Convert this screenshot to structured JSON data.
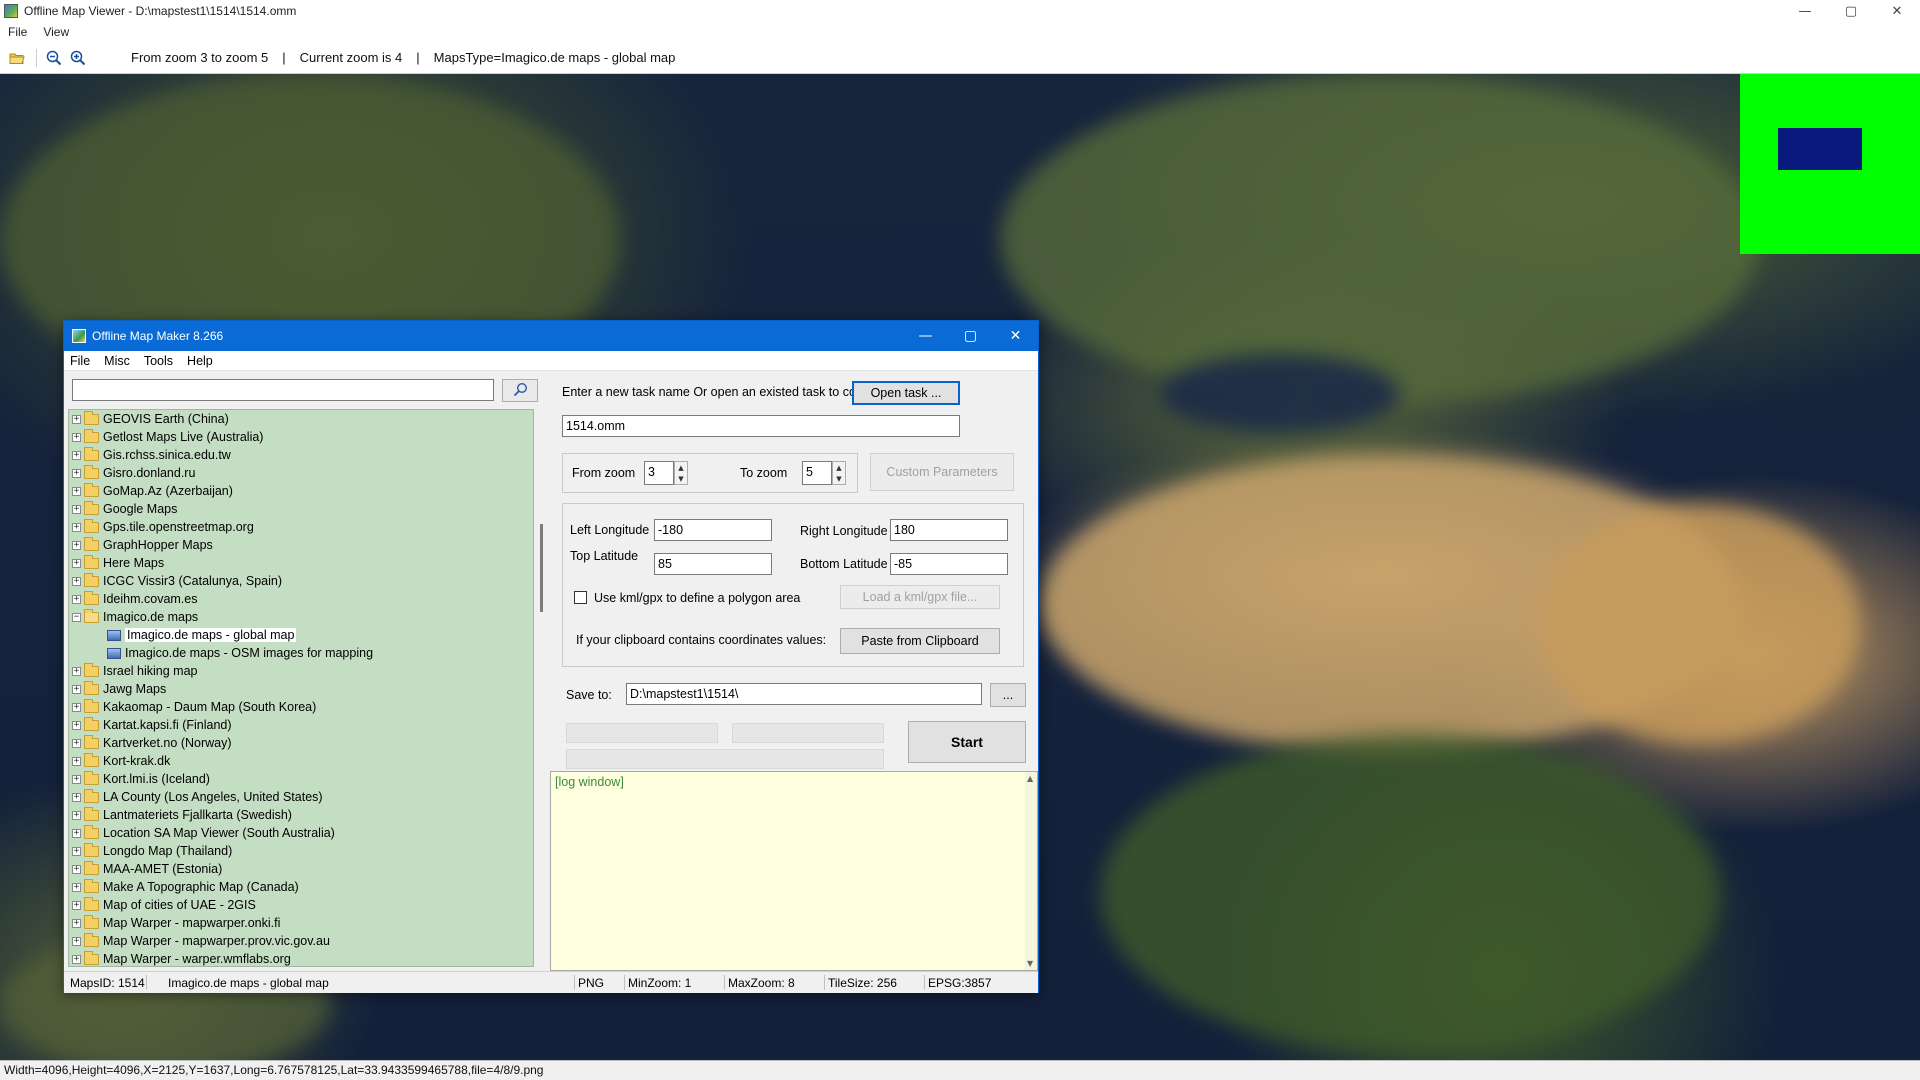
{
  "viewer": {
    "title": "Offline Map Viewer - D:\\mapstest1\\1514\\1514.omm",
    "menu": [
      "File",
      "View"
    ],
    "window_controls": [
      "—",
      "▢",
      "✕"
    ],
    "toolbar": {
      "icons": [
        "open-folder-icon",
        "zoom-out-icon",
        "zoom-in-icon"
      ],
      "zoom_range": "From zoom 3 to zoom 5",
      "current_zoom": "Current zoom is 4",
      "maps_type": "MapsType=Imagico.de maps - global map",
      "separator": "|"
    },
    "status": "Width=4096,Height=4096,X=2125,Y=1637,Long=6.767578125,Lat=33.9433599465788,file=4/8/9.png",
    "overview_colors": {
      "background": "#00ff00",
      "viewport": "#0a1a7c"
    }
  },
  "dialog": {
    "title": "Offline Map Maker 8.266",
    "window_controls": [
      "—",
      "▢",
      "✕"
    ],
    "menu": [
      "File",
      "Misc",
      "Tools",
      "Help"
    ],
    "search": {
      "value": "",
      "icon": "search-icon"
    },
    "tree": [
      {
        "label": "GEOVIS Earth (China)",
        "type": "folder",
        "expander": "+"
      },
      {
        "label": "Getlost Maps Live (Australia)",
        "type": "folder",
        "expander": "+"
      },
      {
        "label": "Gis.rchss.sinica.edu.tw",
        "type": "folder",
        "expander": "+"
      },
      {
        "label": "Gisro.donland.ru",
        "type": "folder",
        "expander": "+"
      },
      {
        "label": "GoMap.Az (Azerbaijan)",
        "type": "folder",
        "expander": "+"
      },
      {
        "label": "Google Maps",
        "type": "folder",
        "expander": "+"
      },
      {
        "label": "Gps.tile.openstreetmap.org",
        "type": "folder",
        "expander": "+"
      },
      {
        "label": "GraphHopper Maps",
        "type": "folder",
        "expander": "+"
      },
      {
        "label": "Here Maps",
        "type": "folder",
        "expander": "+"
      },
      {
        "label": "ICGC Vissir3 (Catalunya, Spain)",
        "type": "folder",
        "expander": "+"
      },
      {
        "label": "Ideihm.covam.es",
        "type": "folder",
        "expander": "+"
      },
      {
        "label": "Imagico.de maps",
        "type": "folder-open",
        "expander": "−"
      },
      {
        "label": "Imagico.de maps - global map",
        "type": "map",
        "selected": true
      },
      {
        "label": "Imagico.de maps - OSM images for mapping",
        "type": "map"
      },
      {
        "label": "Israel hiking map",
        "type": "folder",
        "expander": "+"
      },
      {
        "label": "Jawg Maps",
        "type": "folder",
        "expander": "+"
      },
      {
        "label": "Kakaomap - Daum Map (South Korea)",
        "type": "folder",
        "expander": "+"
      },
      {
        "label": "Kartat.kapsi.fi (Finland)",
        "type": "folder",
        "expander": "+"
      },
      {
        "label": "Kartverket.no (Norway)",
        "type": "folder",
        "expander": "+"
      },
      {
        "label": "Kort-krak.dk",
        "type": "folder",
        "expander": "+"
      },
      {
        "label": "Kort.lmi.is (Iceland)",
        "type": "folder",
        "expander": "+"
      },
      {
        "label": "LA County (Los Angeles, United States)",
        "type": "folder",
        "expander": "+"
      },
      {
        "label": "Lantmateriets Fjallkarta (Swedish)",
        "type": "folder",
        "expander": "+"
      },
      {
        "label": "Location SA Map Viewer (South Australia)",
        "type": "folder",
        "expander": "+"
      },
      {
        "label": "Longdo Map (Thailand)",
        "type": "folder",
        "expander": "+"
      },
      {
        "label": "MAA-AMET (Estonia)",
        "type": "folder",
        "expander": "+"
      },
      {
        "label": "Make A Topographic Map (Canada)",
        "type": "folder",
        "expander": "+"
      },
      {
        "label": "Map of cities of UAE - 2GIS",
        "type": "folder",
        "expander": "+"
      },
      {
        "label": "Map Warper - mapwarper.onki.fi",
        "type": "folder",
        "expander": "+"
      },
      {
        "label": "Map Warper - mapwarper.prov.vic.gov.au",
        "type": "folder",
        "expander": "+"
      },
      {
        "label": "Map Warper - warper.wmflabs.org",
        "type": "folder",
        "expander": "+"
      }
    ],
    "task": {
      "prompt": "Enter a new task name Or open an existed task to continue:",
      "open_label": "Open task ...",
      "name_value": "1514.omm"
    },
    "zoom": {
      "from_label": "From zoom",
      "from_value": "3",
      "to_label": "To zoom",
      "to_value": "5",
      "custom_label": "Custom Parameters"
    },
    "coords": {
      "left_lon_label": "Left Longitude",
      "left_lon_value": "-180",
      "right_lon_label": "Right Longitude",
      "right_lon_value": "180",
      "top_lat_label": "Top Latitude",
      "top_lat_value": "85",
      "bottom_lat_label": "Bottom Latitude",
      "bottom_lat_value": "-85",
      "kml_label": "Use kml/gpx to define a polygon area",
      "kml_checked": false,
      "load_kml_label": "Load a kml/gpx file...",
      "clipboard_prompt": "If your clipboard contains coordinates values:",
      "paste_label": "Paste from Clipboard"
    },
    "save": {
      "label": "Save to:",
      "value": "D:\\mapstest1\\1514\\",
      "browse_label": "...",
      "start_label": "Start"
    },
    "log": {
      "text": "[log window]"
    },
    "status": {
      "maps_id": "MapsID: 1514",
      "map_name": "Imagico.de maps - global map",
      "format": "PNG",
      "min_zoom": "MinZoom: 1",
      "max_zoom": "MaxZoom: 8",
      "tile_size": "TileSize: 256",
      "epsg": "EPSG:3857"
    }
  }
}
